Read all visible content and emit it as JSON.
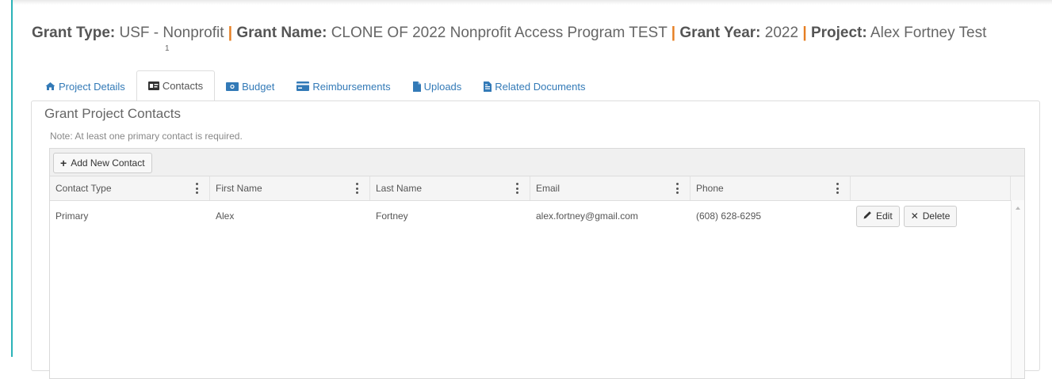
{
  "header": {
    "grant_type_label": "Grant Type:",
    "grant_type_value": "USF - Nonprofit",
    "grant_name_label": "Grant Name:",
    "grant_name_value": "CLONE OF 2022 Nonprofit Access Program TEST",
    "grant_year_label": "Grant Year:",
    "grant_year_value": "2022",
    "project_label": "Project:",
    "project_value": "Alex Fortney Test",
    "separator": "|",
    "stray_mark": "1"
  },
  "tabs": [
    {
      "label": "Project Details",
      "icon": "home-icon",
      "active": false
    },
    {
      "label": "Contacts",
      "icon": "id-card-icon",
      "active": true
    },
    {
      "label": "Budget",
      "icon": "money-icon",
      "active": false
    },
    {
      "label": "Reimbursements",
      "icon": "credit-card-icon",
      "active": false
    },
    {
      "label": "Uploads",
      "icon": "file-icon",
      "active": false
    },
    {
      "label": "Related Documents",
      "icon": "file-text-icon",
      "active": false
    }
  ],
  "panel": {
    "title": "Grant Project Contacts",
    "note": "Note: At least one primary contact is required."
  },
  "grid": {
    "add_button_label": "Add New Contact",
    "columns": [
      "Contact Type",
      "First Name",
      "Last Name",
      "Email",
      "Phone",
      ""
    ],
    "rows": [
      {
        "contact_type": "Primary",
        "first_name": "Alex",
        "last_name": "Fortney",
        "email": "alex.fortney@gmail.com",
        "phone": "(608) 628-6295"
      }
    ],
    "edit_label": "Edit",
    "delete_label": "Delete"
  },
  "colors": {
    "accent_link": "#337ab7",
    "separator": "#e67e22",
    "left_rule": "#2bb3b8"
  }
}
